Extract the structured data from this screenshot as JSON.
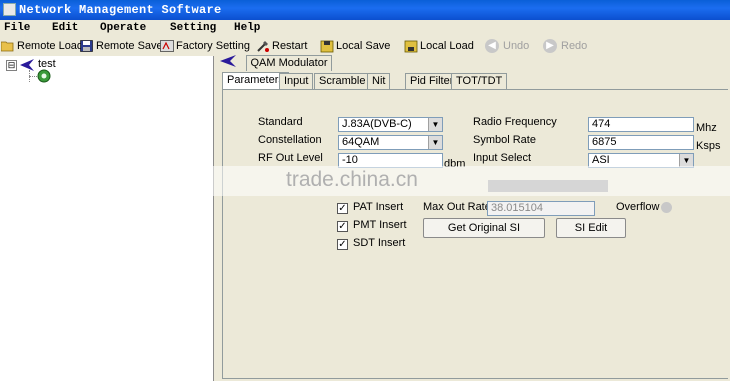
{
  "window": {
    "title": "Network Management Software"
  },
  "menu": [
    "File",
    "Edit",
    "Operate",
    "Setting",
    "Help"
  ],
  "toolbar": {
    "remote_load": "Remote  Load",
    "remote_save": "Remote Save",
    "factory_setting": "Factory Setting",
    "restart": "Restart",
    "local_save": "Local Save",
    "local_load": "Local Load",
    "undo": "Undo",
    "redo": "Redo"
  },
  "tree": {
    "root_label": "test",
    "expander": "⊟"
  },
  "module": {
    "title": "QAM Modulator"
  },
  "tabs": [
    "Parameters",
    "Input",
    "Scramble",
    "Nit",
    "Pid Filter",
    "TOT/TDT"
  ],
  "form": {
    "standard_label": "Standard",
    "standard_value": "J.83A(DVB-C)",
    "constellation_label": "Constellation",
    "constellation_value": "64QAM",
    "rf_out_level_label": "RF Out Level",
    "rf_out_level_value": "-10",
    "rf_unit": "dbm",
    "radio_frequency_label": "Radio Frequency",
    "radio_frequency_value": "474",
    "freq_unit": "Mhz",
    "symbol_rate_label": "Symbol Rate",
    "symbol_rate_value": "6875",
    "symbol_unit": "Ksps",
    "input_select_label": "Input Select",
    "input_select_value": "ASI"
  },
  "insert": {
    "pat_label": "PAT Insert",
    "pmt_label": "PMT Insert",
    "sdt_label": "SDT Insert",
    "check_mark": "✓",
    "pat_checked": true,
    "pmt_checked": true,
    "sdt_checked": true
  },
  "rate": {
    "max_out_rate_label": "Max Out Rate",
    "max_out_rate_value": "38.015104",
    "overflow_label": "Overflow"
  },
  "buttons": {
    "get_original_si": "Get Original SI",
    "si_edit": "SI Edit"
  },
  "watermark": "trade.china.cn",
  "colors": {
    "title_bar": "#1b6df0",
    "window_bg": "#ece9d8",
    "input_border": "#7f9db9"
  }
}
